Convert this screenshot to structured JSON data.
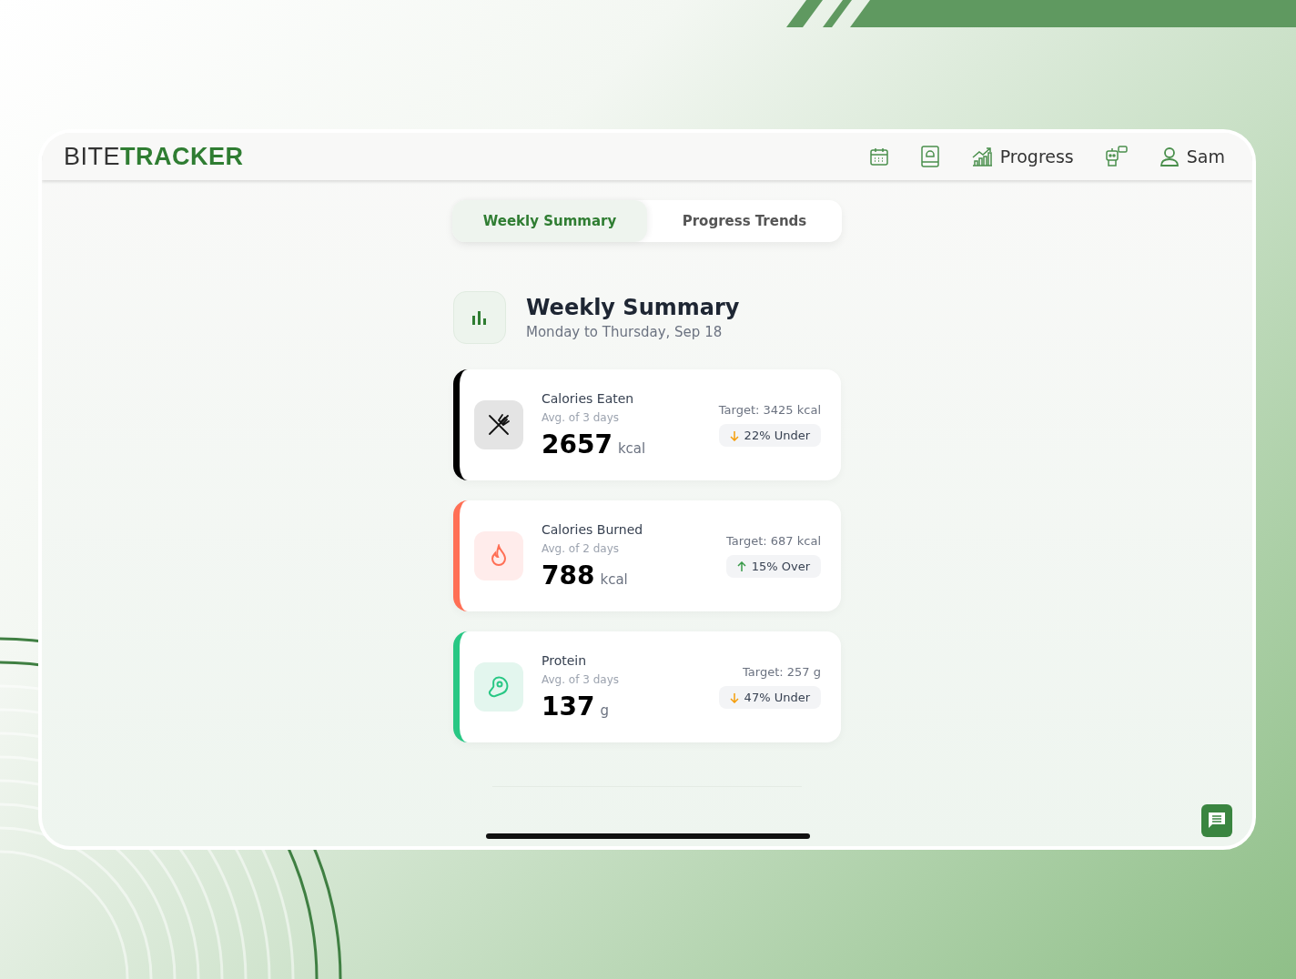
{
  "logo": {
    "light": "BITE",
    "bold": "TRACKER"
  },
  "nav": [
    {
      "kind": "calendar"
    },
    {
      "kind": "book"
    },
    {
      "kind": "chart",
      "label": "Progress"
    },
    {
      "kind": "robot"
    },
    {
      "kind": "user",
      "label": "Sam"
    }
  ],
  "tabs": [
    {
      "label": "Weekly Summary",
      "selected": true
    },
    {
      "label": "Progress Trends",
      "selected": false
    }
  ],
  "header": {
    "title": "Weekly Summary",
    "subtitle": "Monday to Thursday, Sep 18"
  },
  "cards": [
    {
      "kind": "eaten",
      "color": "#000000",
      "title": "Calories Eaten",
      "subtitle": "Avg. of 3 days",
      "value": "2657",
      "unit": "kcal",
      "target": "Target: 3425 kcal",
      "trend": {
        "kind": "down",
        "text": "22% Under"
      }
    },
    {
      "kind": "burned",
      "color": "#ff6f55",
      "title": "Calories Burned",
      "subtitle": "Avg. of 2 days",
      "value": "788",
      "unit": "kcal",
      "target": "Target: 687 kcal",
      "trend": {
        "kind": "up",
        "text": "15% Over"
      }
    },
    {
      "kind": "protein",
      "color": "#28c784",
      "title": "Protein",
      "subtitle": "Avg. of 3 days",
      "value": "137",
      "unit": "g",
      "target": "Target: 257 g",
      "trend": {
        "kind": "down",
        "text": "47% Under"
      }
    }
  ]
}
